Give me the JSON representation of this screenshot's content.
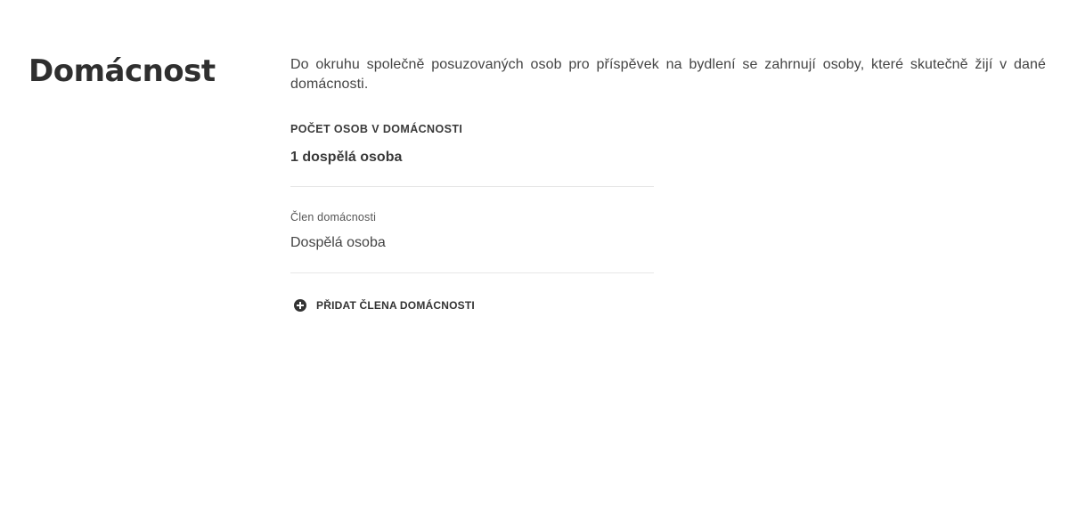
{
  "section": {
    "title": "Domácnost",
    "intro": "Do okruhu společně posuzovaných osob pro příspěvek na bydlení se zahrnují osoby, které skutečně žijí v dané domácnosti."
  },
  "household_count": {
    "label": "POČET OSOB V DOMÁCNOSTI",
    "value": "1 dospělá osoba"
  },
  "members": [
    {
      "label": "Člen domácnosti",
      "value": "Dospělá osoba"
    }
  ],
  "add_member": {
    "label": "PŘIDAT ČLENA DOMÁCNOSTI",
    "icon": "plus-circle-icon"
  }
}
